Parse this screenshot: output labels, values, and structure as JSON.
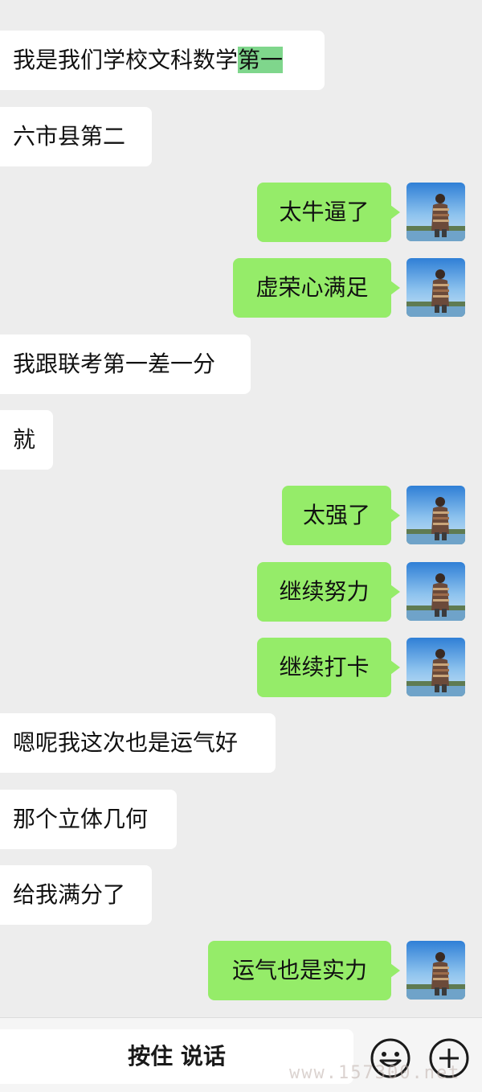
{
  "messages": [
    {
      "side": "in",
      "text_plain": "我是我们学校文科数学",
      "text_highlight": "第一"
    },
    {
      "side": "in",
      "text": "六市县第二"
    },
    {
      "side": "out",
      "text": "太牛逼了"
    },
    {
      "side": "out",
      "text": "虚荣心满足"
    },
    {
      "side": "in",
      "text": "我跟联考第一差一分"
    },
    {
      "side": "in",
      "text": "就"
    },
    {
      "side": "out",
      "text": "太强了"
    },
    {
      "side": "out",
      "text": "继续努力"
    },
    {
      "side": "out",
      "text": "继续打卡"
    },
    {
      "side": "in",
      "text": "嗯呢我这次也是运气好"
    },
    {
      "side": "in",
      "text": "那个立体几何"
    },
    {
      "side": "in",
      "text": "给我满分了"
    },
    {
      "side": "out",
      "text": "运气也是实力"
    }
  ],
  "input_bar": {
    "hold_to_talk_label": "按住 说话",
    "emoji_icon": "emoji-icon",
    "plus_icon": "plus-icon"
  },
  "watermark": "www.157300.net",
  "colors": {
    "background": "#ededed",
    "incoming_bubble": "#ffffff",
    "outgoing_bubble": "#95ec69",
    "selection_highlight": "#7fd68c"
  }
}
